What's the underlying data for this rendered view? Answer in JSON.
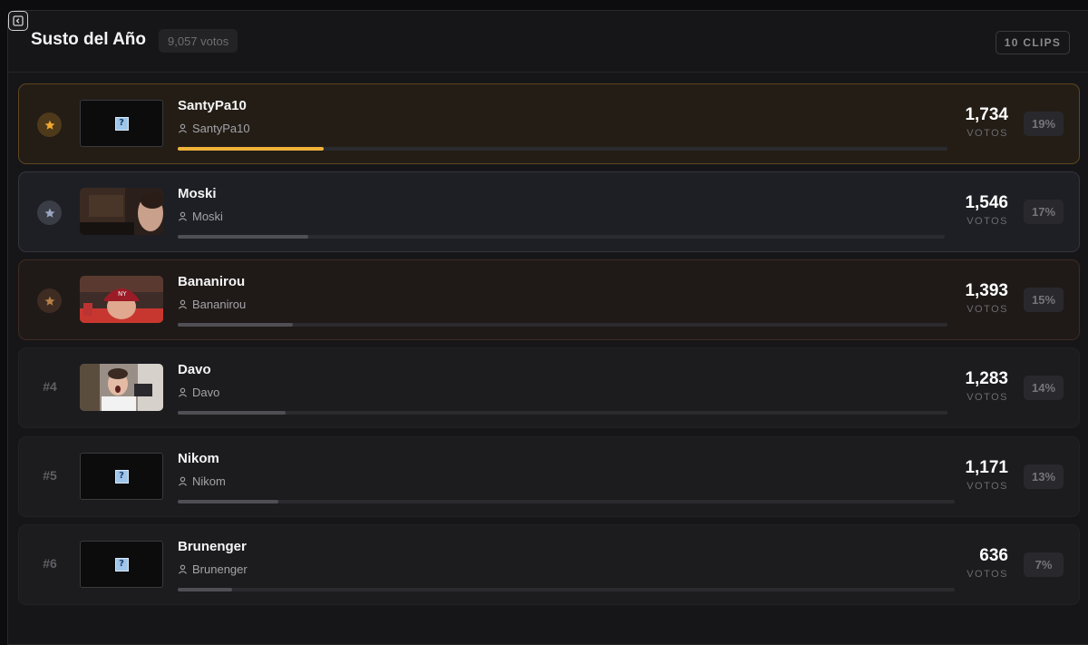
{
  "header": {
    "title": "Susto del Año",
    "total_votes": "9,057 votos",
    "clips_badge": "10 CLIPS"
  },
  "clips": [
    {
      "rank": "1",
      "medal": "gold",
      "title": "SantyPa10",
      "author": "SantyPa10",
      "votes": "1,734",
      "votes_label": "VOTOS",
      "percent": "19%",
      "share": 0.19,
      "thumbnail": "placeholder"
    },
    {
      "rank": "2",
      "medal": "silver",
      "title": "Moski",
      "author": "Moski",
      "votes": "1,546",
      "votes_label": "VOTOS",
      "percent": "17%",
      "share": 0.17,
      "thumbnail": "webcam-dark"
    },
    {
      "rank": "3",
      "medal": "bronze",
      "title": "Bananirou",
      "author": "Bananirou",
      "votes": "1,393",
      "votes_label": "VOTOS",
      "percent": "15%",
      "share": 0.15,
      "thumbnail": "webcam-red-cap"
    },
    {
      "rank": "#4",
      "medal": "none",
      "title": "Davo",
      "author": "Davo",
      "votes": "1,283",
      "votes_label": "VOTOS",
      "percent": "14%",
      "share": 0.14,
      "thumbnail": "webcam-scream"
    },
    {
      "rank": "#5",
      "medal": "none",
      "title": "Nikom",
      "author": "Nikom",
      "votes": "1,171",
      "votes_label": "VOTOS",
      "percent": "13%",
      "share": 0.13,
      "thumbnail": "placeholder"
    },
    {
      "rank": "#6",
      "medal": "none",
      "title": "Brunenger",
      "author": "Brunenger",
      "votes": "636",
      "votes_label": "VOTOS",
      "percent": "7%",
      "share": 0.07,
      "thumbnail": "placeholder"
    }
  ],
  "colors": {
    "gold": "#f0b23a",
    "silver": "#9ba6bf",
    "bronze": "#b67f45",
    "bar_default": "#4f4f55"
  },
  "icons": {
    "collapse": "sidebar-collapse-icon",
    "medal": "star-icon",
    "author": "user-icon",
    "missing_thumbnail": "question-mark-icon"
  }
}
